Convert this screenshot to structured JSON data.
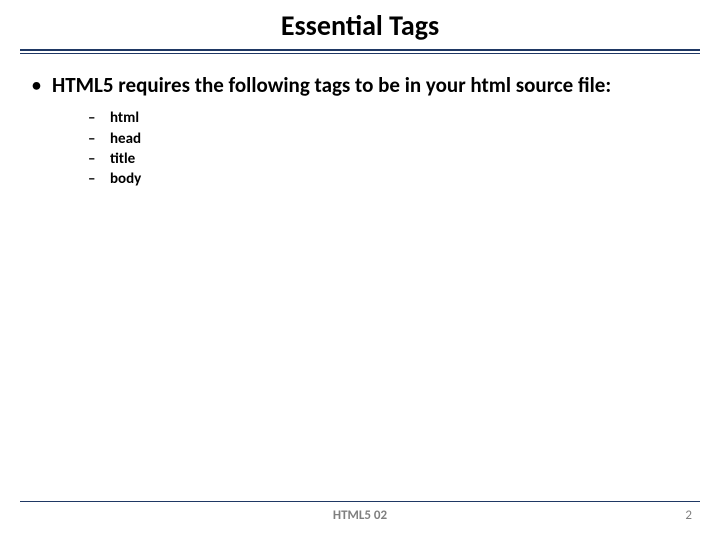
{
  "title": "Essential Tags",
  "lead": "HTML5 requires the following tags to be in your html source file:",
  "tags": [
    "html",
    "head",
    "title",
    "body"
  ],
  "footer": {
    "center": "HTML5 02",
    "page": "2"
  }
}
